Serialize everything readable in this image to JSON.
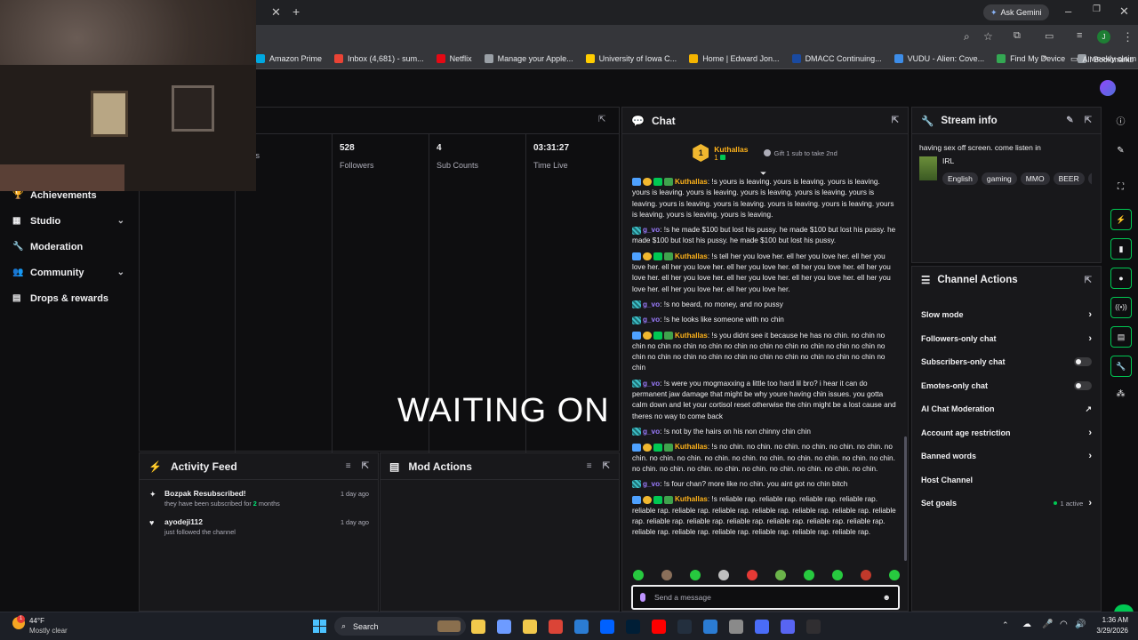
{
  "browser": {
    "gemini_label": "Ask Gemini",
    "profile_initial": "J",
    "bookmarks": [
      {
        "label": "Amazon Prime",
        "color": "#00a8e1"
      },
      {
        "label": "Inbox (4,681) - sum...",
        "color": "#ea4335"
      },
      {
        "label": "Netflix",
        "color": "#e50914"
      },
      {
        "label": "Manage your Apple...",
        "color": "#9aa0a6"
      },
      {
        "label": "University of Iowa C...",
        "color": "#ffcd00"
      },
      {
        "label": "Home | Edward Jon...",
        "color": "#f4b400"
      },
      {
        "label": "DMACC Continuing...",
        "color": "#1a4aa0"
      },
      {
        "label": "VUDU - Alien: Cove...",
        "color": "#3d8de8"
      },
      {
        "label": "Find My Device",
        "color": "#34a853"
      },
      {
        "label": "weekly claim",
        "color": "#9aa0a6"
      }
    ],
    "all_bookmarks": "All Bookmarks"
  },
  "sidenav": {
    "items": [
      {
        "label": "Achievements",
        "chevron": false
      },
      {
        "label": "Studio",
        "chevron": true
      },
      {
        "label": "Moderation",
        "chevron": false
      },
      {
        "label": "Community",
        "chevron": true
      },
      {
        "label": "Drops & rewards",
        "chevron": false
      }
    ]
  },
  "stats": [
    {
      "value": "",
      "label": "wers"
    },
    {
      "value": "528",
      "label": "Followers"
    },
    {
      "value": "4",
      "label": "Sub Counts"
    },
    {
      "value": "03:31:27",
      "label": "Time Live"
    }
  ],
  "overlay_text": "WAITING ON GVO",
  "activity_feed": {
    "title": "Activity Feed",
    "items": [
      {
        "name": "Bozpak Resubscribed!",
        "detail_pre": "they have been subscribed for ",
        "detail_hl": "2",
        "detail_post": " months",
        "time": "1 day ago",
        "icon": "star-icon"
      },
      {
        "name": "ayodeji112",
        "detail_pre": "just followed the channel",
        "detail_hl": "",
        "detail_post": "",
        "time": "1 day ago",
        "icon": "heart-icon"
      }
    ]
  },
  "mod_actions": {
    "title": "Mod Actions"
  },
  "chat": {
    "title": "Chat",
    "pinned": {
      "rank": "1",
      "name": "Kuthallas",
      "count": "1",
      "gift": "Gift 1 sub to take 2nd"
    },
    "messages": [
      {
        "user": "Kuthallas",
        "type": 1,
        "text": "!s yours is leaving. yours is leaving. yours is leaving. yours is leaving. yours is leaving. yours is leaving. yours is leaving. yours is leaving. yours is leaving. yours is leaving. yours is leaving. yours is leaving. yours is leaving. yours is leaving. yours is leaving."
      },
      {
        "user": "g_vo",
        "type": 2,
        "text": "!s he made $100 but lost his pussy. he made $100 but lost his pussy. he made $100 but lost his pussy. he made $100 but lost his pussy."
      },
      {
        "user": "Kuthallas",
        "type": 1,
        "text": "!s tell her you love her. ell her you love her. ell her you love her. ell her you love her. ell her you love her. ell her you love her. ell her you love her. ell her you love her. ell her you love her. ell her you love her. ell her you love her. ell her you love her. ell her you love her."
      },
      {
        "user": "g_vo",
        "type": 2,
        "text": "!s no beard, no money, and no pussy"
      },
      {
        "user": "g_vo",
        "type": 2,
        "text": "!s he looks like someone with no chin"
      },
      {
        "user": "Kuthallas",
        "type": 1,
        "text": "!s you didnt see it because he has no chin. no chin no chin no chin no chin no chin no chin no chin no chin no chin no chin no chin no chin no chin no chin no chin no chin no chin no chin no chin no chin no chin no chin"
      },
      {
        "user": "g_vo",
        "type": 2,
        "text": "!s were you mogmaxxing a little too hard lil bro? i hear it can do permanent jaw damage that might be why youre having chin issues. you gotta calm down and let your cortisol reset otherwise the chin might be a lost cause and theres no way to come back"
      },
      {
        "user": "g_vo",
        "type": 2,
        "text": "!s not by the hairs on his non chinny chin chin"
      },
      {
        "user": "Kuthallas",
        "type": 1,
        "text": "!s no chin. no chin. no chin. no chin. no chin. no chin. no chin. no chin. no chin. no chin. no chin. no chin. no chin. no chin. no chin. no chin. no chin. no chin. no chin. no chin. no chin. no chin. no chin. no chin. no chin."
      },
      {
        "user": "g_vo",
        "type": 2,
        "text": "!s four chan? more like no chin. you aint got no chin bitch"
      },
      {
        "user": "Kuthallas",
        "type": 1,
        "text": "!s reliable rap. reliable rap. reliable rap. reliable rap. reliable rap. reliable rap. reliable rap. reliable rap. reliable rap. reliable rap. reliable rap. reliable rap. reliable rap. reliable rap. reliable rap. reliable rap. reliable rap. reliable rap. reliable rap. reliable rap. reliable rap. reliable rap. reliable rap."
      }
    ],
    "input_placeholder": "Send a message"
  },
  "stream_info": {
    "title": "Stream info",
    "stream_title": "having sex off screen. come listen in",
    "category": "IRL",
    "tags": [
      "English",
      "gaming",
      "MMO",
      "BEER",
      "re"
    ]
  },
  "channel_actions": {
    "title": "Channel Actions",
    "items": [
      {
        "label": "Slow mode",
        "control": "chevron",
        "extra": ""
      },
      {
        "label": "Followers-only chat",
        "control": "chevron",
        "extra": ""
      },
      {
        "label": "Subscribers-only chat",
        "control": "toggle",
        "extra": ""
      },
      {
        "label": "Emotes-only chat",
        "control": "toggle",
        "extra": ""
      },
      {
        "label": "AI Chat Moderation",
        "control": "external",
        "extra": ""
      },
      {
        "label": "Account age restriction",
        "control": "chevron",
        "extra": ""
      },
      {
        "label": "Banned words",
        "control": "chevron",
        "extra": ""
      },
      {
        "label": "Host Channel",
        "control": "none",
        "extra": ""
      },
      {
        "label": "Set goals",
        "control": "chevron",
        "extra": "1 active"
      }
    ]
  },
  "taskbar": {
    "weather_temp": "44°F",
    "weather_desc": "Mostly clear",
    "search_label": "Search",
    "time": "1:36 AM",
    "date": "3/29/2026"
  },
  "colors": {
    "accent": "#9147ff",
    "green": "#00c853"
  }
}
